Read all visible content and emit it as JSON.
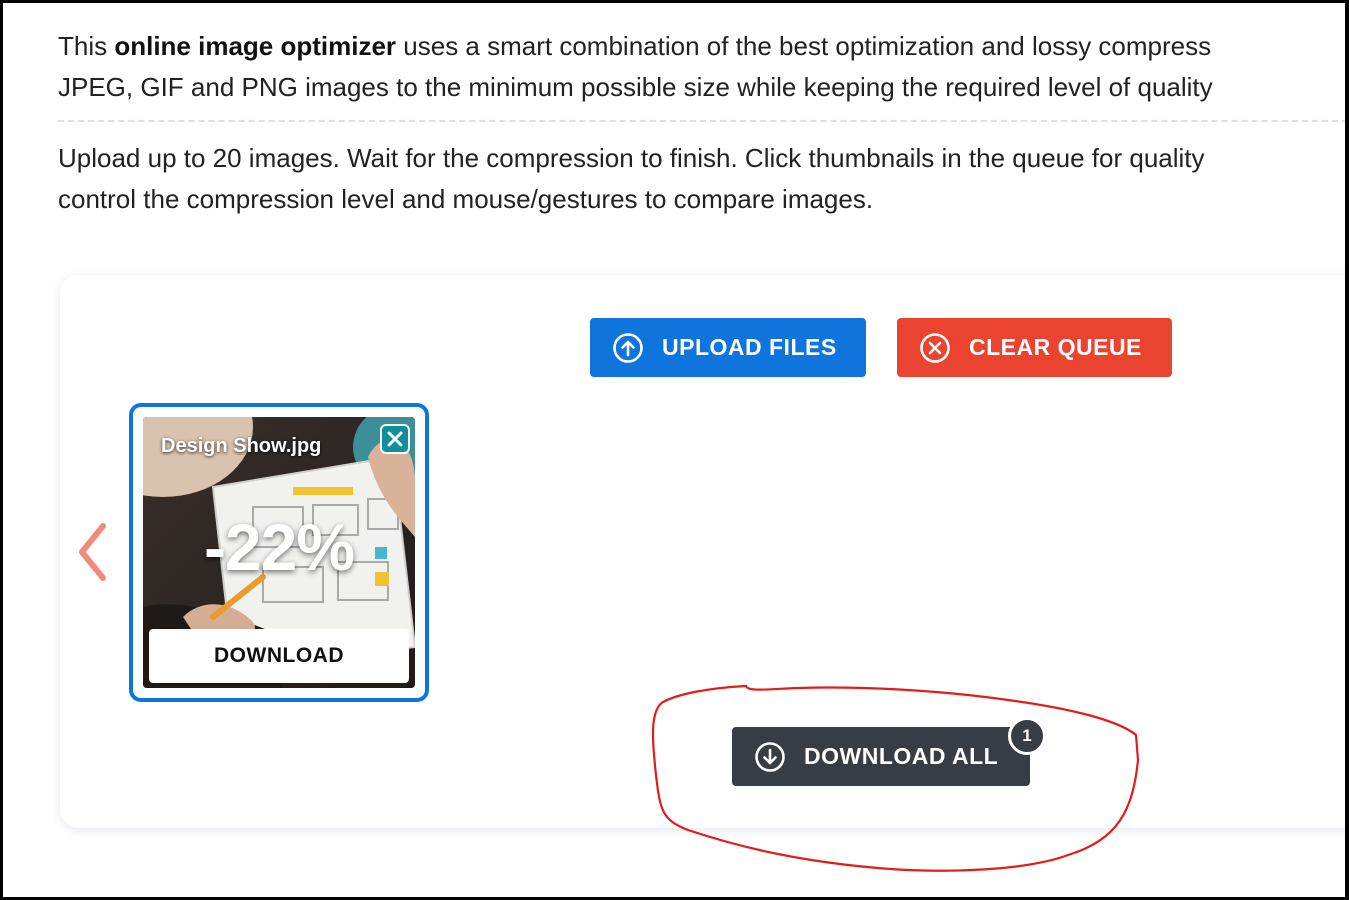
{
  "intro": {
    "line1_pre": "This ",
    "line1_bold": "online image optimizer",
    "line1_post": " uses a smart combination of the best optimization and lossy compress",
    "line2": "JPEG, GIF and PNG images to the minimum possible size while keeping the required level of quality",
    "line3": "Upload up to 20 images. Wait for the compression to finish. Click thumbnails in the queue for quality",
    "line4": "control the compression level and mouse/gestures to compare images."
  },
  "toolbar": {
    "upload_label": "UPLOAD FILES",
    "upload_icon": "arrow-up-circle-icon",
    "clear_label": "CLEAR QUEUE",
    "clear_icon": "x-circle-icon",
    "upload_color": "#0f75dd",
    "clear_color": "#ea4431"
  },
  "queue": {
    "prev_icon": "chevron-left-icon",
    "prev_color": "#f08a7c",
    "items": [
      {
        "filename": "Design Show.jpg",
        "savings": "-22%",
        "download_label": "DOWNLOAD",
        "close_icon": "close-icon"
      }
    ]
  },
  "download_all": {
    "label": "DOWNLOAD ALL",
    "icon": "arrow-down-circle-icon",
    "count": "1",
    "color": "#363d45"
  },
  "annotation": {
    "shape": "hand-drawn circle",
    "color": "#e21b1b"
  }
}
